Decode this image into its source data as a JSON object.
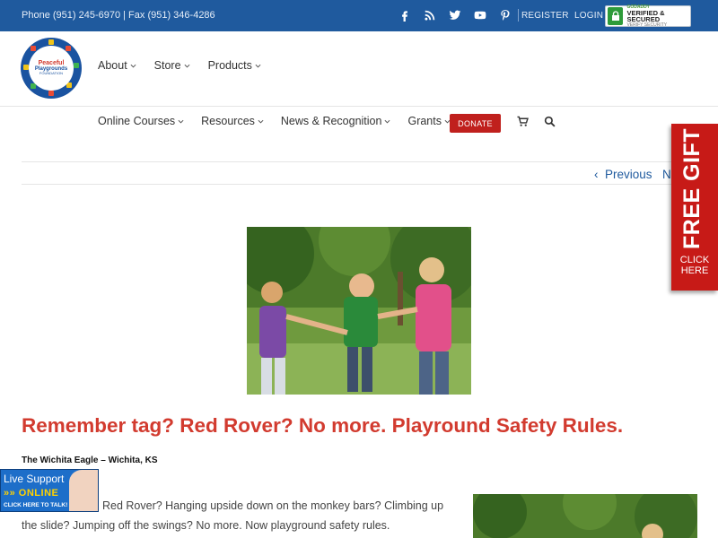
{
  "topbar": {
    "contact": "Phone (951) 245-6970 | Fax (951) 346-4286",
    "register": "REGISTER",
    "login": "LOGIN",
    "godaddy": {
      "line1": "GODADDY",
      "line2": "VERIFIED & SECURED",
      "line3": "VERIFY SECURITY"
    },
    "socials": [
      "facebook-icon",
      "rss-icon",
      "twitter-icon",
      "youtube-icon",
      "pinterest-icon"
    ]
  },
  "logo": {
    "line1": "Peaceful",
    "line2": "Playgrounds",
    "line3": "FOUNDATION"
  },
  "nav_primary": [
    {
      "label": "About"
    },
    {
      "label": "Store"
    },
    {
      "label": "Products"
    }
  ],
  "nav_secondary": [
    {
      "label": "Online Courses"
    },
    {
      "label": "Resources"
    },
    {
      "label": "News & Recognition"
    },
    {
      "label": "Grants"
    }
  ],
  "donate_label": "DONATE",
  "pager": {
    "previous": "Previous",
    "next": "N"
  },
  "free_gift": {
    "headline": "FREE GIFT",
    "cta_line1": "CLICK",
    "cta_line2": "HERE"
  },
  "article": {
    "title": "Remember tag? Red Rover? No more. Playround Safety Rules.",
    "source": "The Wichita Eagle – Wichita, KS",
    "body": "Red Rover? Hanging upside down on the monkey bars? Climbing up the slide? Jumping off the swings? No more. Now  playground safety rules."
  },
  "live_support": {
    "line1": "Live Support",
    "line2": "ONLINE",
    "line3": "CLICK HERE TO TALK!"
  },
  "colors": {
    "brand_blue": "#1f5a9e",
    "accent_red": "#c0201d",
    "title_red": "#d23b2f"
  }
}
